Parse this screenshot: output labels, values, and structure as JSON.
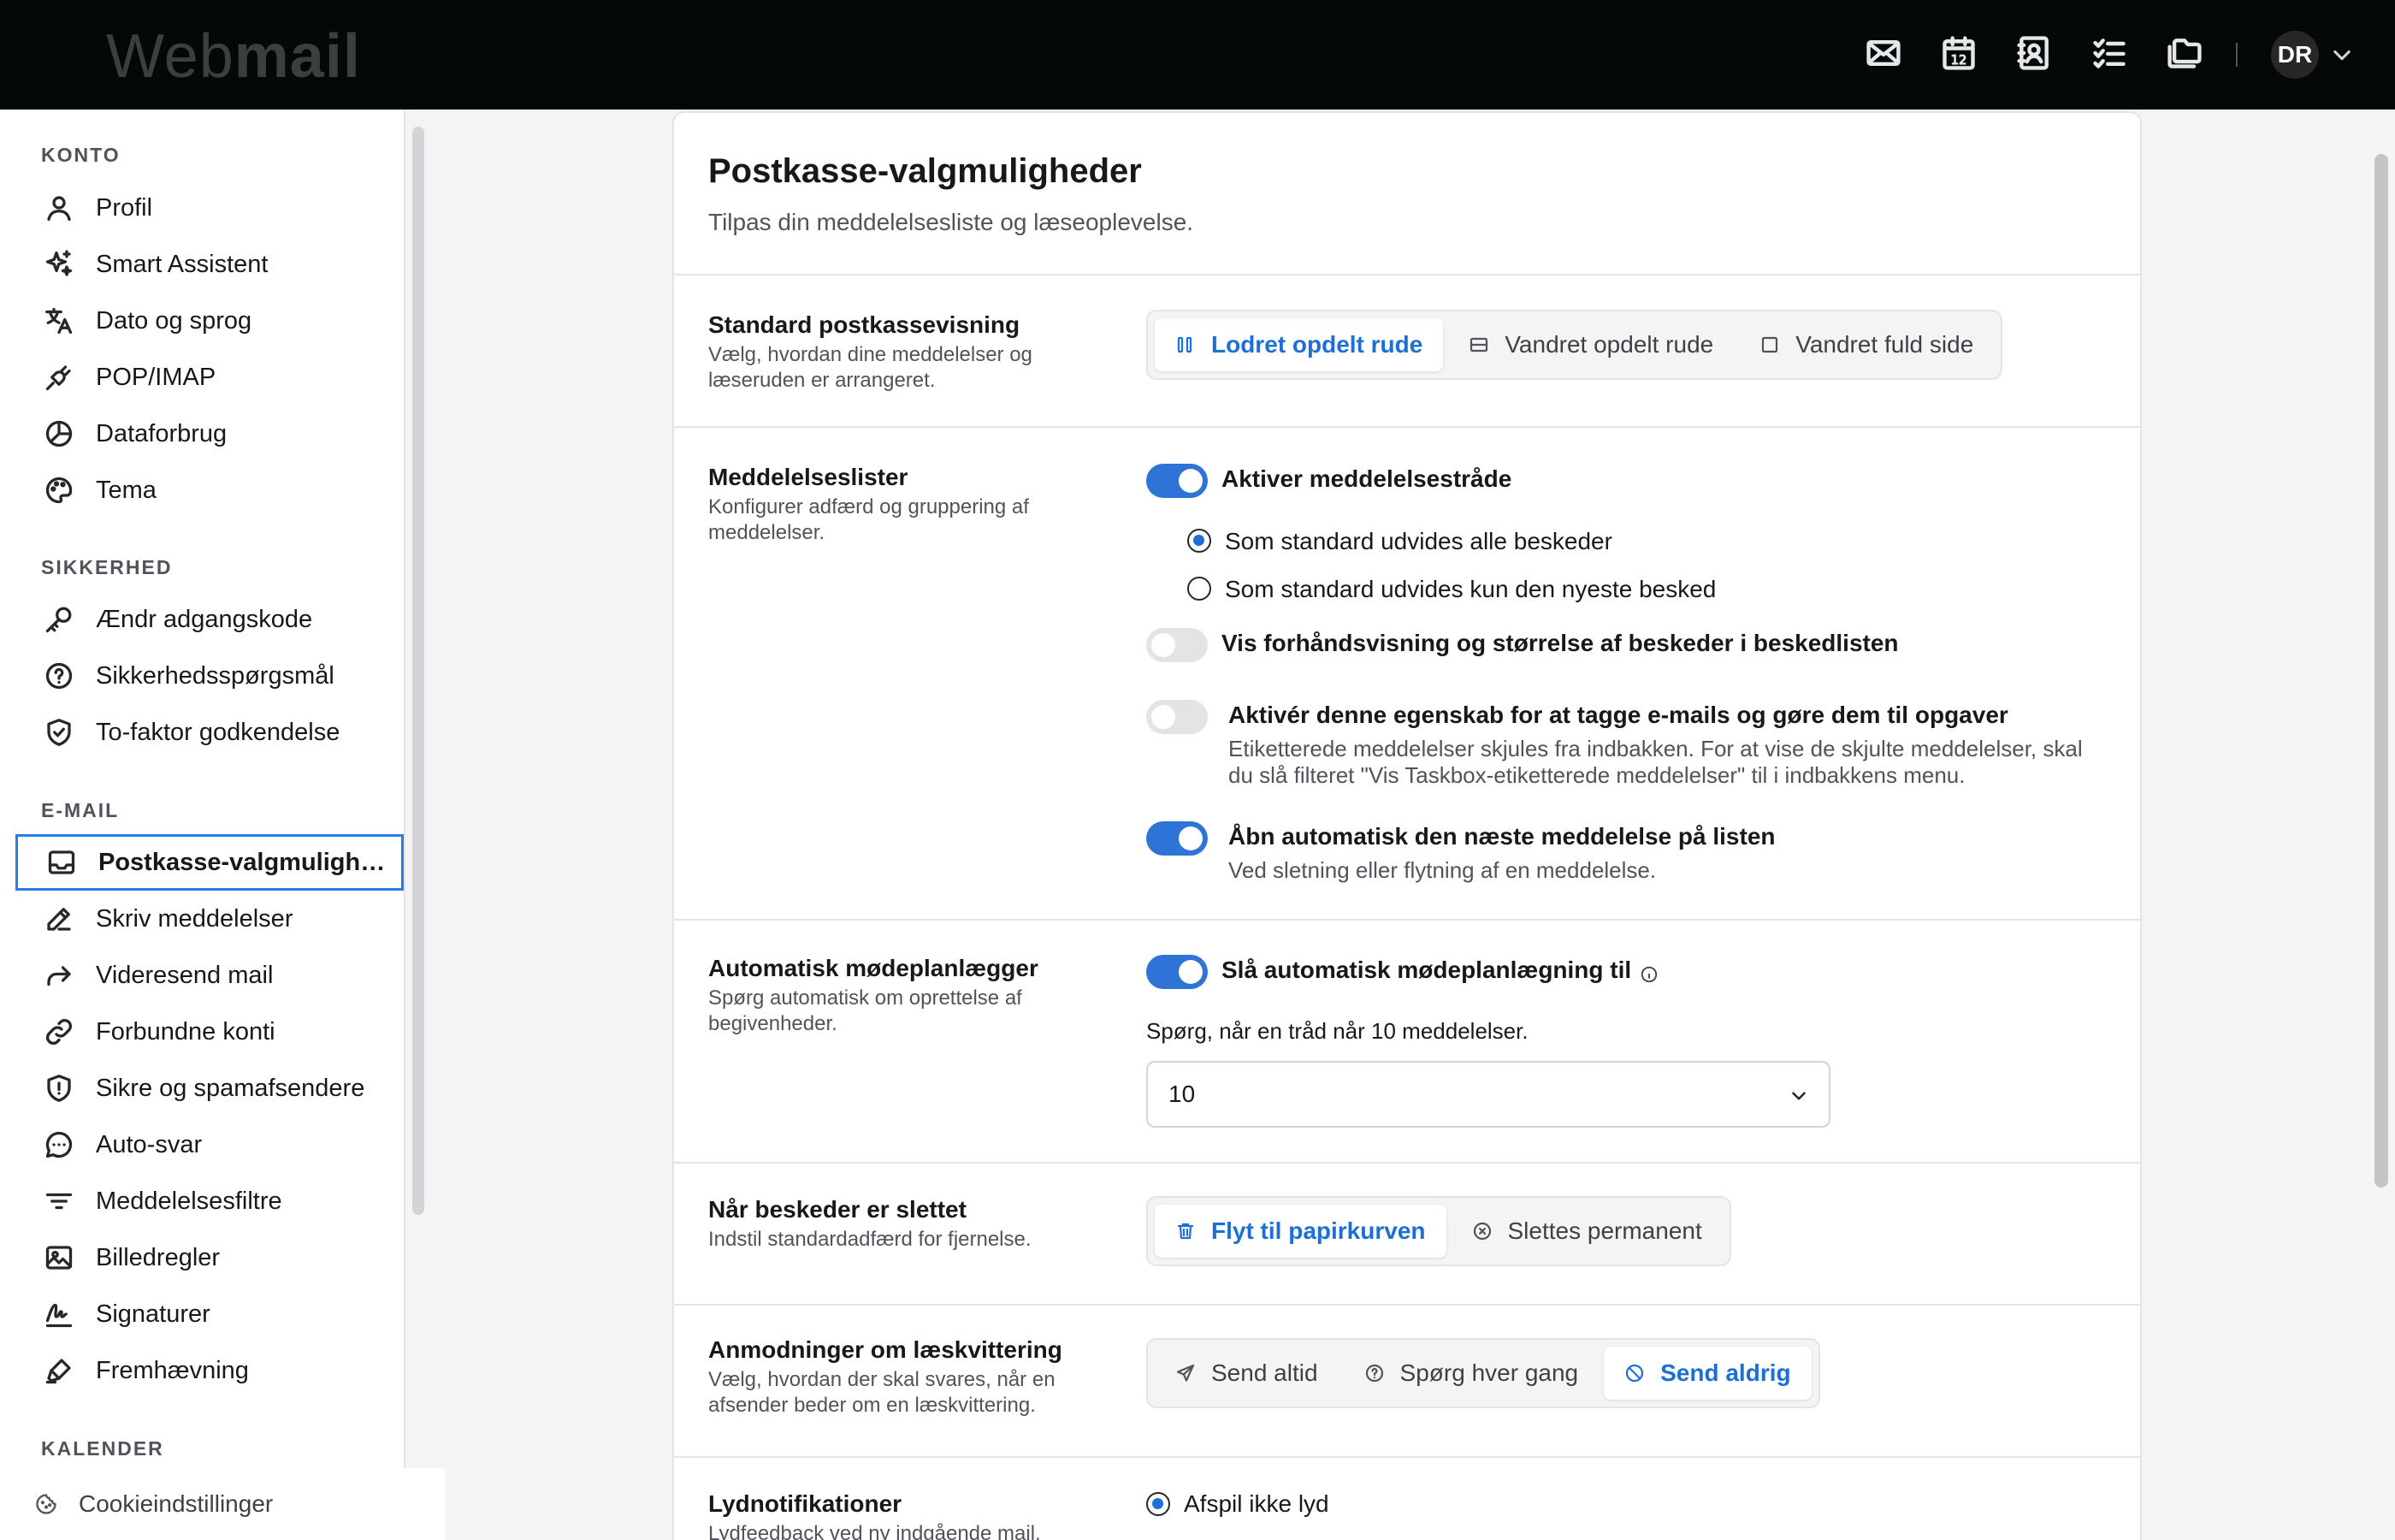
{
  "app": {
    "logo_light": "Web",
    "logo_bold": "mail"
  },
  "topbar": {
    "icons": [
      "mail-icon",
      "calendar-icon",
      "contacts-icon",
      "tasks-icon",
      "files-icon"
    ],
    "calendar_day": "12",
    "avatar_initials": "DR"
  },
  "sidebar": {
    "sections": {
      "konto": "KONTO",
      "sikkerhed": "SIKKERHED",
      "email": "E-MAIL",
      "kalender": "KALENDER"
    },
    "konto_items": [
      {
        "label": "Profil",
        "icon": "user-icon"
      },
      {
        "label": "Smart Assistent",
        "icon": "sparkles-icon"
      },
      {
        "label": "Dato og sprog",
        "icon": "language-icon"
      },
      {
        "label": "POP/IMAP",
        "icon": "plug-icon"
      },
      {
        "label": "Dataforbrug",
        "icon": "pie-chart-icon"
      },
      {
        "label": "Tema",
        "icon": "palette-icon"
      }
    ],
    "sikkerhed_items": [
      {
        "label": "Ændr adgangskode",
        "icon": "key-icon"
      },
      {
        "label": "Sikkerhedsspørgsmål",
        "icon": "question-circle-icon"
      },
      {
        "label": "To-faktor godkendelse",
        "icon": "shield-check-icon"
      }
    ],
    "email_items": [
      {
        "label": "Postkasse-valgmuligheder",
        "icon": "inbox-icon",
        "active": true
      },
      {
        "label": "Skriv meddelelser",
        "icon": "pencil-icon"
      },
      {
        "label": "Videresend mail",
        "icon": "forward-icon"
      },
      {
        "label": "Forbundne konti",
        "icon": "link-icon"
      },
      {
        "label": "Sikre og spamafsendere",
        "icon": "shield-alert-icon"
      },
      {
        "label": "Auto-svar",
        "icon": "chat-bubble-icon"
      },
      {
        "label": "Meddelelsesfiltre",
        "icon": "filter-icon"
      },
      {
        "label": "Billedregler",
        "icon": "image-icon"
      },
      {
        "label": "Signaturer",
        "icon": "signature-icon"
      },
      {
        "label": "Fremhævning",
        "icon": "highlighter-icon"
      }
    ],
    "cookie_label": "Cookieindstillinger"
  },
  "page": {
    "title": "Postkasse-valgmuligheder",
    "subtitle": "Tilpas din meddelelsesliste og læseoplevelse."
  },
  "layout_section": {
    "title": "Standard postkassevisning",
    "desc": "Vælg, hvordan dine meddelelser og læseruden er arrangeret.",
    "options": [
      "Lodret opdelt rude",
      "Vandret opdelt rude",
      "Vandret fuld side"
    ],
    "selected": "Lodret opdelt rude"
  },
  "lists_section": {
    "title": "Meddelelseslister",
    "desc": "Konfigurer adfærd og gruppering af meddelelser.",
    "threads_toggle": {
      "label": "Aktiver meddelelsestråde",
      "on": true
    },
    "expand_all": "Som standard udvides alle beskeder",
    "expand_newest": "Som standard udvides kun den nyeste besked",
    "preview_toggle": {
      "label": "Vis forhåndsvisning og størrelse af beskeder i beskedlisten",
      "on": false
    },
    "taskbox_toggle": {
      "label": "Aktivér denne egenskab for at tagge e-mails og gøre dem til opgaver",
      "desc": "Etiketterede meddelelser skjules fra indbakken. For at vise de skjulte meddelelser, skal du slå filteret \"Vis Taskbox-etiketterede meddelelser\" til i indbakkens menu.",
      "on": false
    },
    "auto_open_toggle": {
      "label": "Åbn automatisk den næste meddelelse på listen",
      "desc": "Ved sletning eller flytning af en meddelelse.",
      "on": true
    }
  },
  "meeting_section": {
    "title": "Automatisk mødeplanlægger",
    "desc": "Spørg automatisk om oprettelse af begivenheder.",
    "toggle_label": "Slå automatisk mødeplanlægning til",
    "prompt": "Spørg, når en tråd når 10 meddelelser.",
    "select_value": "10"
  },
  "delete_section": {
    "title": "Når beskeder er slettet",
    "desc": "Indstil standardadfærd for fjernelse.",
    "options": [
      "Flyt til papirkurven",
      "Slettes permanent"
    ],
    "selected": "Flyt til papirkurven"
  },
  "receipt_section": {
    "title": "Anmodninger om læskvittering",
    "desc": "Vælg, hvordan der skal svares, når en afsender beder om en læskvittering.",
    "options": [
      "Send altid",
      "Spørg hver gang",
      "Send aldrig"
    ],
    "selected": "Send aldrig"
  },
  "sound_section": {
    "title": "Lydnotifikationer",
    "desc": "Lydfeedback ved ny indgående mail.",
    "option_label": "Afspil ikke lyd"
  },
  "colors": {
    "accent": "#2d74d6",
    "topbar": "#040807"
  }
}
